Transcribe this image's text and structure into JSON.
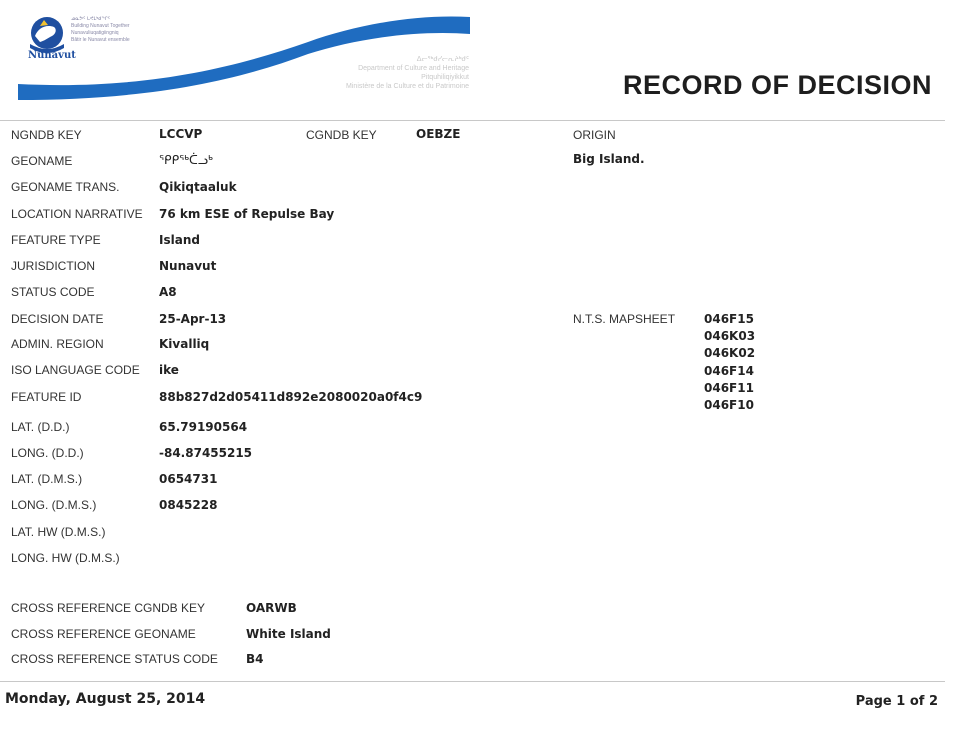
{
  "header": {
    "logo_lines": [
      "ᓄᓇᕗᑦ ᒐᕙᒪᒃᑯᖏᑦ",
      "Building Nunavut Together",
      "Nunavuliuqatigiingniq",
      "Bâtir le Nunavut ensemble"
    ],
    "logo_caption": "Nunavut",
    "department_lines": [
      "ᐃᓕᖅᑯᓯᓕᕆᔨᒃᑯᑦ",
      "Department of Culture and Heritage",
      "Pitquhiliqiyikkut",
      "Ministère de la Culture et du Patrimoine"
    ],
    "title": "RECORD OF DECISION",
    "colors": {
      "swoosh": "#1f6cc0",
      "title": "#1e1e1e"
    }
  },
  "fields": [
    {
      "label": "NGNDB KEY",
      "value": "LCCVP"
    },
    {
      "label": "GEONAME",
      "value": "ᕿᑭᖅᑖᓗᒃ"
    },
    {
      "label": "GEONAME TRANS.",
      "value": "Qikiqtaaluk"
    },
    {
      "label": "LOCATION NARRATIVE",
      "value": "76 km ESE of Repulse Bay"
    },
    {
      "label": "FEATURE TYPE",
      "value": "Island"
    },
    {
      "label": "JURISDICTION",
      "value": "Nunavut"
    },
    {
      "label": "STATUS CODE",
      "value": "A8"
    },
    {
      "label": "DECISION DATE",
      "value": "25-Apr-13"
    },
    {
      "label": "ADMIN. REGION",
      "value": "Kivalliq"
    },
    {
      "label": "ISO LANGUAGE CODE",
      "value": "ike"
    },
    {
      "label": "FEATURE ID",
      "value": "88b827d2d05411d892e2080020a0f4c9"
    },
    {
      "label": "LAT. (D.D.)",
      "value": "65.79190564"
    },
    {
      "label": "LONG. (D.D.)",
      "value": "-84.87455215"
    },
    {
      "label": "LAT. (D.M.S.)",
      "value": "0654731"
    },
    {
      "label": "LONG. (D.M.S.)",
      "value": "0845228"
    },
    {
      "label": "LAT. HW (D.M.S.)",
      "value": ""
    },
    {
      "label": "LONG. HW (D.M.S.)",
      "value": ""
    }
  ],
  "cgndb": {
    "label": "CGNDB KEY",
    "value": "OEBZE"
  },
  "origin": {
    "label": "ORIGIN",
    "value": "Big Island."
  },
  "nts": {
    "label": "N.T.S. MAPSHEET",
    "values": [
      "046F15",
      "046K03",
      "046K02",
      "046F14",
      "046F11",
      "046F10"
    ]
  },
  "cross_reference": [
    {
      "label": "CROSS REFERENCE CGNDB KEY",
      "value": "OARWB"
    },
    {
      "label": "CROSS REFERENCE GEONAME",
      "value": "White Island"
    },
    {
      "label": "CROSS REFERENCE STATUS CODE",
      "value": "B4"
    }
  ],
  "footer": {
    "date": "Monday, August 25, 2014",
    "page": "Page 1 of 2"
  }
}
